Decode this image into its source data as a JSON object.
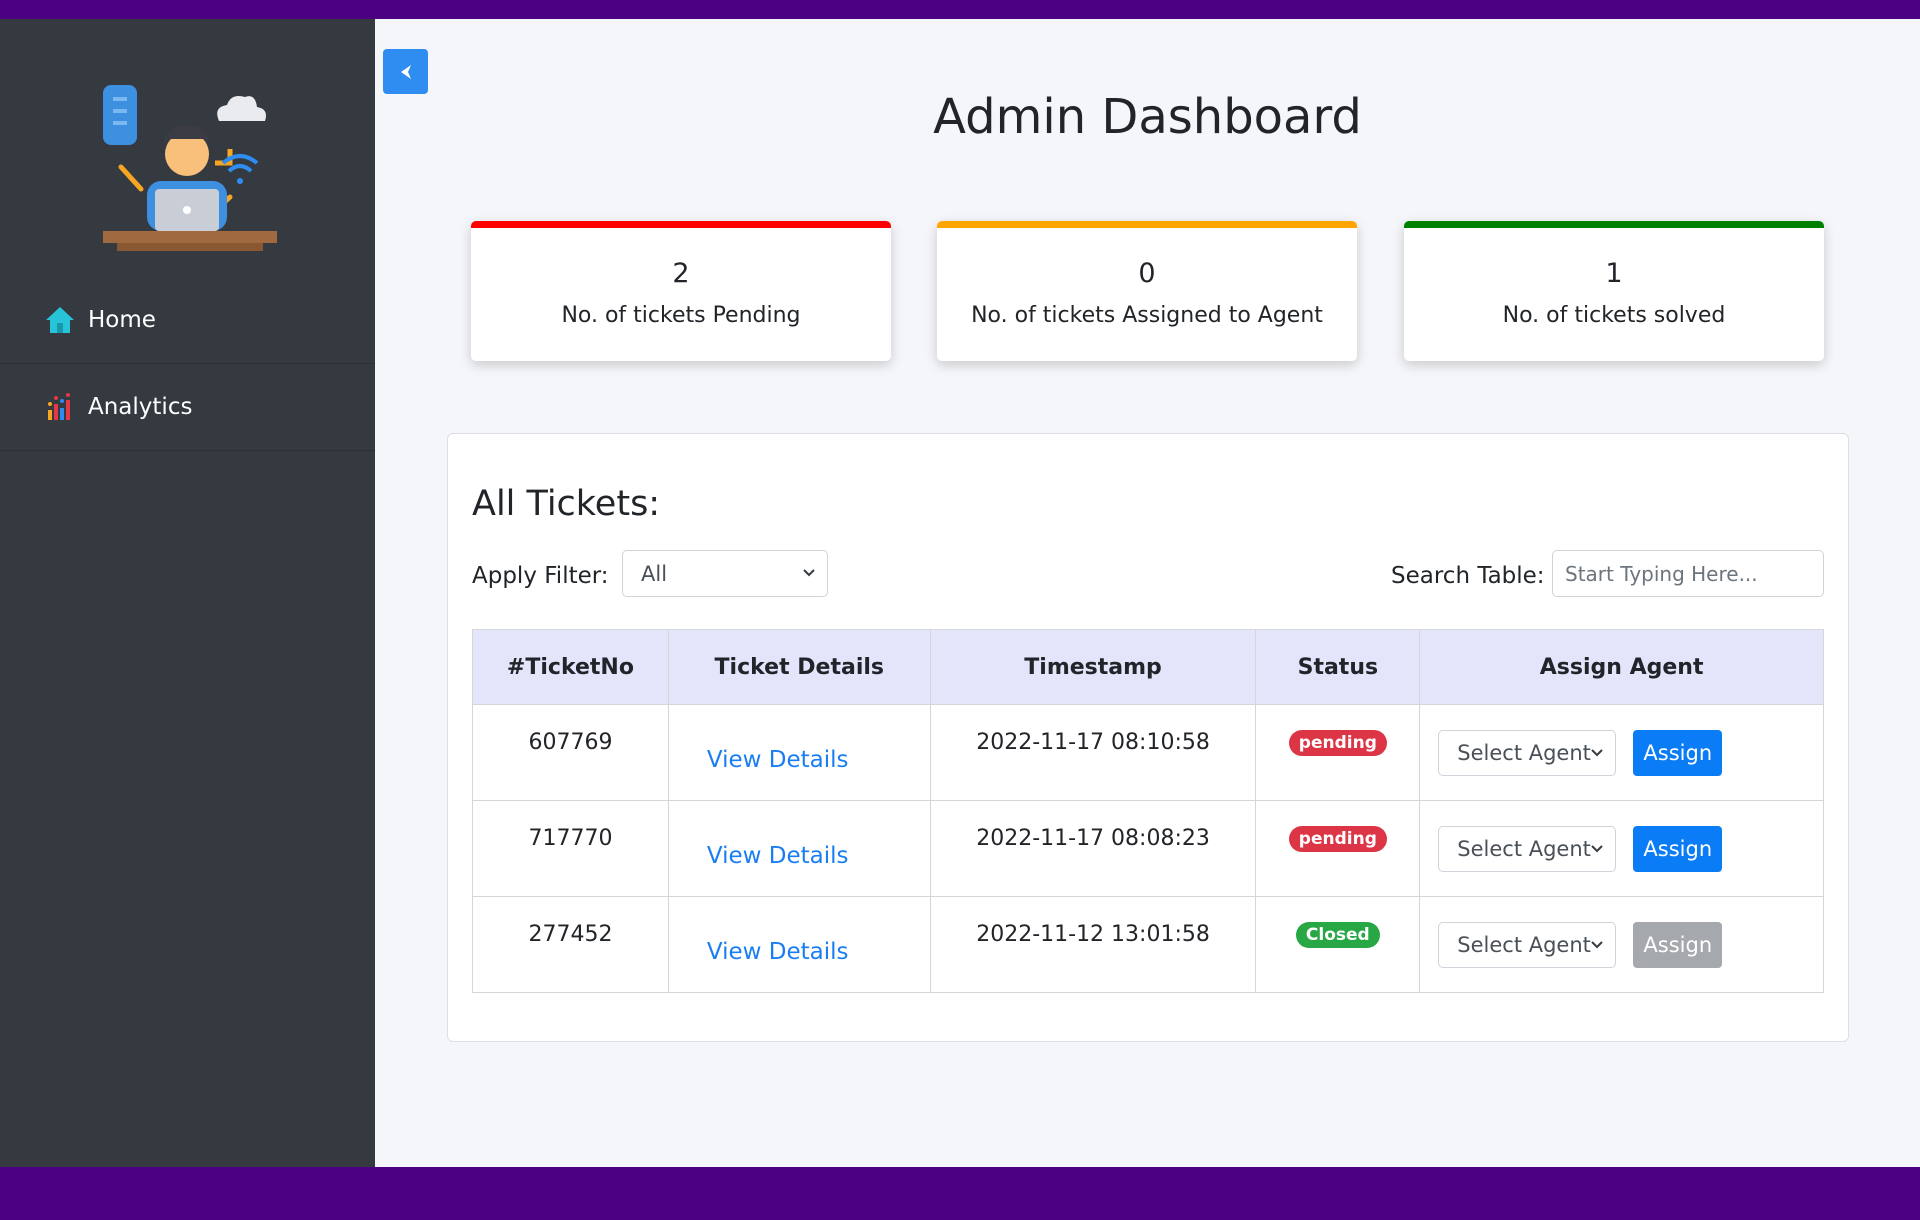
{
  "sidebar": {
    "items": [
      {
        "label": "Home",
        "icon": "home-icon"
      },
      {
        "label": "Analytics",
        "icon": "bar-chart-icon"
      }
    ]
  },
  "header": {
    "title": "Admin Dashboard"
  },
  "stats": [
    {
      "count": "2",
      "label": "No. of tickets Pending",
      "color": "#ff0000"
    },
    {
      "count": "0",
      "label": "No. of tickets Assigned to Agent",
      "color": "#ffa500"
    },
    {
      "count": "1",
      "label": "No. of tickets solved",
      "color": "#008000"
    }
  ],
  "tickets": {
    "heading": "All Tickets:",
    "filter_label": "Apply Filter:",
    "filter_value": "All",
    "search_label": "Search Table:",
    "search_placeholder": "Start Typing Here...",
    "columns": [
      "#TicketNo",
      "Ticket Details",
      "Timestamp",
      "Status",
      "Assign Agent"
    ],
    "rows": [
      {
        "ticket_no": "607769",
        "details": "View Details",
        "timestamp": "2022-11-17 08:10:58",
        "status": "pending",
        "agent": "Select Agent",
        "assign": "Assign"
      },
      {
        "ticket_no": "717770",
        "details": "View Details",
        "timestamp": "2022-11-17 08:08:23",
        "status": "pending",
        "agent": "Select Agent",
        "assign": "Assign"
      },
      {
        "ticket_no": "277452",
        "details": "View Details",
        "timestamp": "2022-11-12 13:01:58",
        "status": "Closed",
        "agent": "Select Agent",
        "assign": "Assign"
      }
    ]
  },
  "colors": {
    "frame": "#4b0082",
    "sidebar": "#343a40",
    "primary": "#0a7cf5",
    "pending_badge": "#dc3545",
    "closed_badge": "#28a745",
    "disabled_button": "#a5a9ad",
    "table_header": "#e4e5fb"
  }
}
